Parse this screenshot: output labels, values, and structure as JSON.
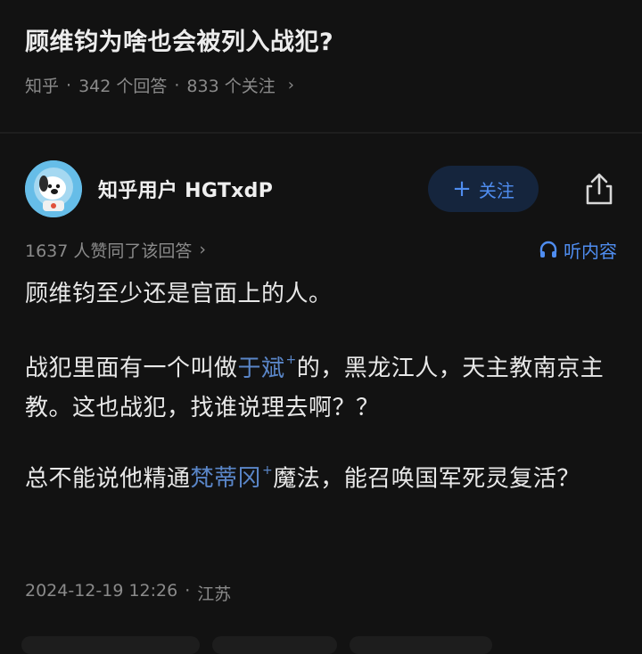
{
  "question": {
    "title": "顾维钧为啥也会被列入战犯?",
    "source": "知乎",
    "answers_count": "342 个回答",
    "followers_count": "833 个关注",
    "separator": "·",
    "chevron": "›"
  },
  "author": {
    "name": "知乎用户 HGTxdP",
    "avatar_icon": "dog-astronaut-avatar-icon"
  },
  "actions": {
    "follow_label": "关注",
    "follow_plus": "+",
    "share_icon": "share-icon",
    "accent_color": "#4f8df0"
  },
  "answer_meta": {
    "upvote_text": "1637 人赞同了该回答",
    "chevron": "›",
    "listen_label": "听内容",
    "listen_icon": "headphones-icon"
  },
  "answer": {
    "p1": "顾维钧至少还是官面上的人。",
    "p2_before": "战犯里面有一个叫做",
    "p2_link": "于斌",
    "p2_after": "的，黑龙江人，天主教南京主教。这也战犯，找谁说理去啊？？",
    "p3_before": "总不能说他精通",
    "p3_link": "梵蒂冈",
    "p3_after": "魔法，能召唤国军死灵复活？",
    "link_marker": "+"
  },
  "footer": {
    "datetime": "2024-12-19 12:26",
    "separator": "·",
    "location": "江苏"
  }
}
